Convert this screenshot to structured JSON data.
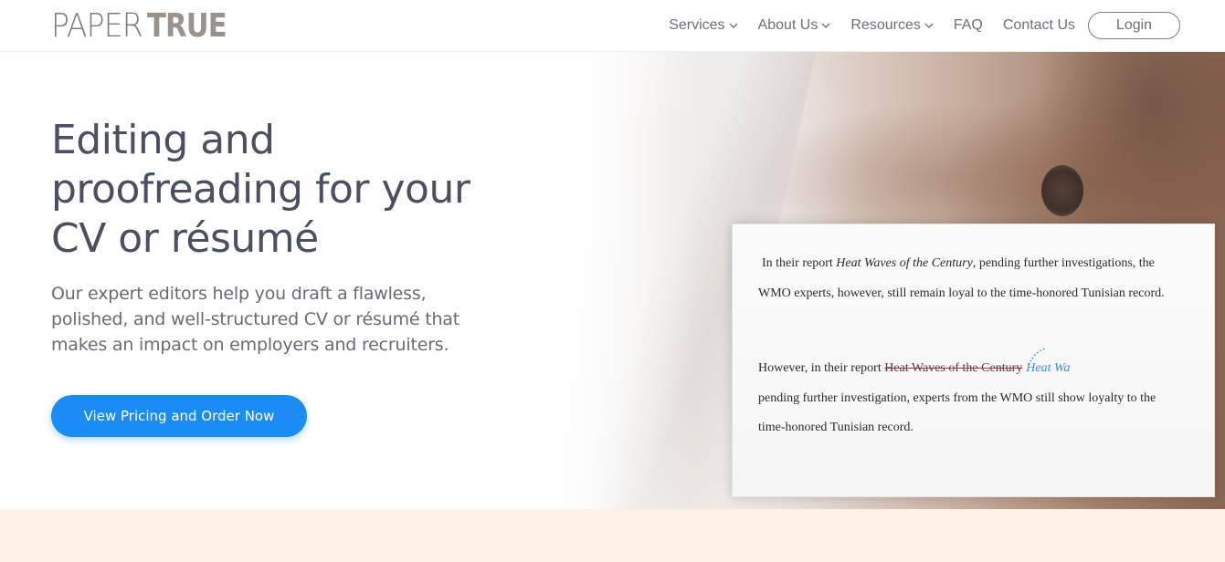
{
  "brand": {
    "logo_light": "PAPER",
    "logo_bold": "TRUE"
  },
  "nav": {
    "items": [
      {
        "label": "Services",
        "has_dropdown": true
      },
      {
        "label": "About Us",
        "has_dropdown": true
      },
      {
        "label": "Resources",
        "has_dropdown": true
      },
      {
        "label": "FAQ",
        "has_dropdown": false
      },
      {
        "label": "Contact Us",
        "has_dropdown": false
      }
    ],
    "login_label": "Login"
  },
  "hero": {
    "title": "Editing and proofreading for your CV or résumé",
    "subtitle": "Our expert editors help you draft a flawless, polished, and well-structured CV or résumé that makes an impact on employers and recruiters.",
    "cta_label": "View Pricing and Order Now"
  },
  "document": {
    "p1_line1_start": "In their report",
    "p1_line1_italic": "Heat Waves of the Century",
    "p1_line1_end": ", pending further investigations, the",
    "p1_line2": "WMO experts, however, still remain loyal to the time-honored Tunisian record.",
    "p2_line1_start": "However, in their report",
    "p2_line1_struck": "Heat Waves of the Century",
    "p2_line1_insert": "Heat Wa",
    "p2_line2": "pending further investigation, experts from the WMO still show loyalty to the",
    "p2_line3": "time-honored Tunisian record."
  },
  "colors": {
    "cta": "#1a8cf2",
    "heading": "#4b5060",
    "band": "#fdf1e7",
    "insert": "#3a8fd6",
    "strike": "#b0332d"
  }
}
